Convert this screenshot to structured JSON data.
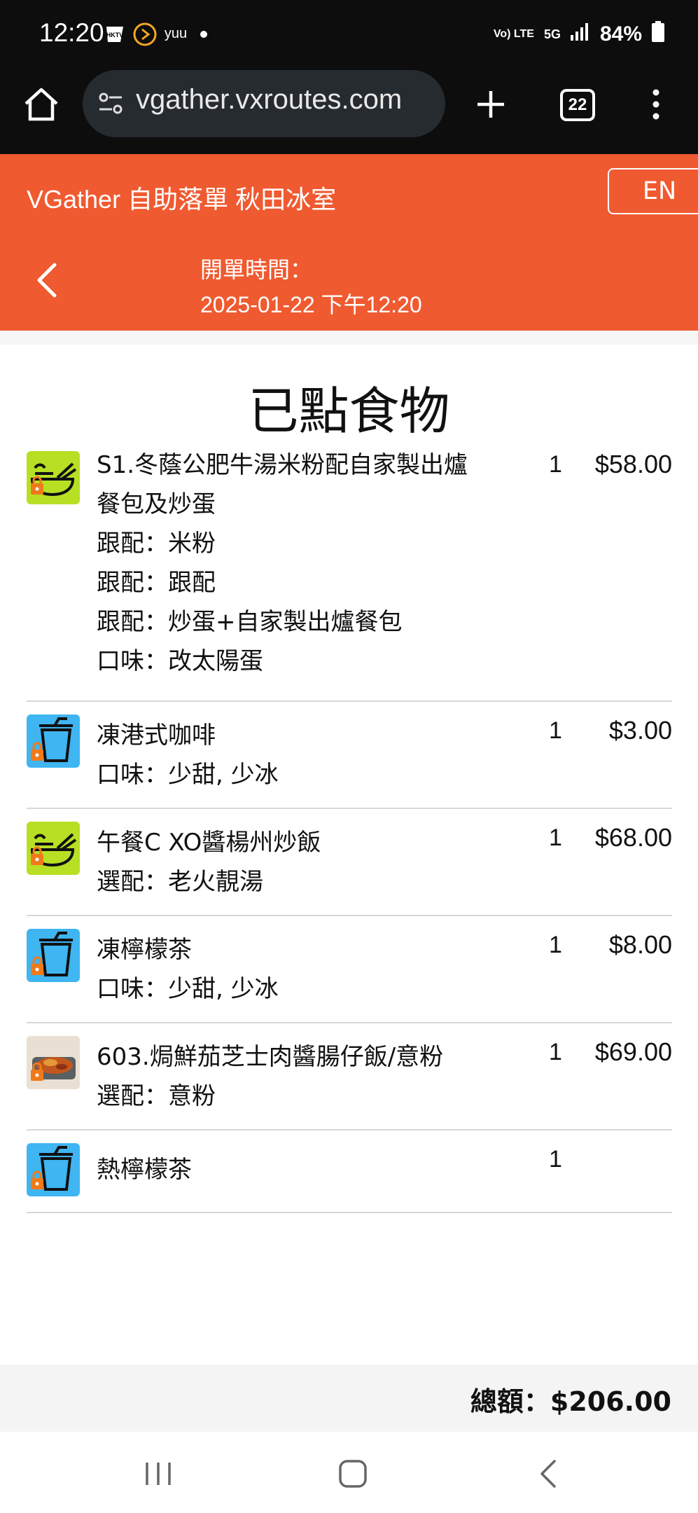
{
  "status_bar": {
    "time": "12:20",
    "notification_icons": [
      "hktv-icon",
      "play-arrow-icon",
      "yuu-icon"
    ],
    "network": "Vo) LTE",
    "network_type": "5G",
    "battery": "84%"
  },
  "browser": {
    "url": "vgather.vxroutes.com",
    "tab_count": "22"
  },
  "header": {
    "title": "VGather 自助落單 秋田冰室",
    "lang_button": "EN",
    "open_time_label": "開單時間：",
    "open_time_value": "2025-01-22 下午12:20",
    "accent_color": "#f05a30"
  },
  "page": {
    "title": "已點食物"
  },
  "items": [
    {
      "icon": "bowl-icon",
      "name_lines": [
        "S1.冬蔭公肥牛湯米粉配自家製出爐",
        "餐包及炒蛋"
      ],
      "options": [
        "跟配：米粉",
        "跟配：跟配",
        "跟配：炒蛋+自家製出爐餐包",
        "口味：改太陽蛋"
      ],
      "qty": "1",
      "price": "$58.00"
    },
    {
      "icon": "drink-cup-icon",
      "name_lines": [
        "凍港式咖啡"
      ],
      "options": [
        "口味：少甜, 少冰"
      ],
      "qty": "1",
      "price": "$3.00"
    },
    {
      "icon": "bowl-icon",
      "name_lines": [
        "午餐C XO醬楊州炒飯"
      ],
      "options": [
        "選配：老火靚湯"
      ],
      "qty": "1",
      "price": "$68.00"
    },
    {
      "icon": "drink-cup-icon",
      "name_lines": [
        "凍檸檬茶"
      ],
      "options": [
        "口味：少甜, 少冰"
      ],
      "qty": "1",
      "price": "$8.00"
    },
    {
      "icon": "food-photo-icon",
      "name_lines": [
        "603.焗鮮茄芝士肉醬腸仔飯/意粉"
      ],
      "options": [
        "選配：意粉"
      ],
      "qty": "1",
      "price": "$69.00"
    },
    {
      "icon": "drink-cup-icon",
      "name_lines": [
        "熱檸檬茶"
      ],
      "options": [],
      "qty": "1",
      "price": ""
    }
  ],
  "total": {
    "text": "總額：$206.00"
  }
}
